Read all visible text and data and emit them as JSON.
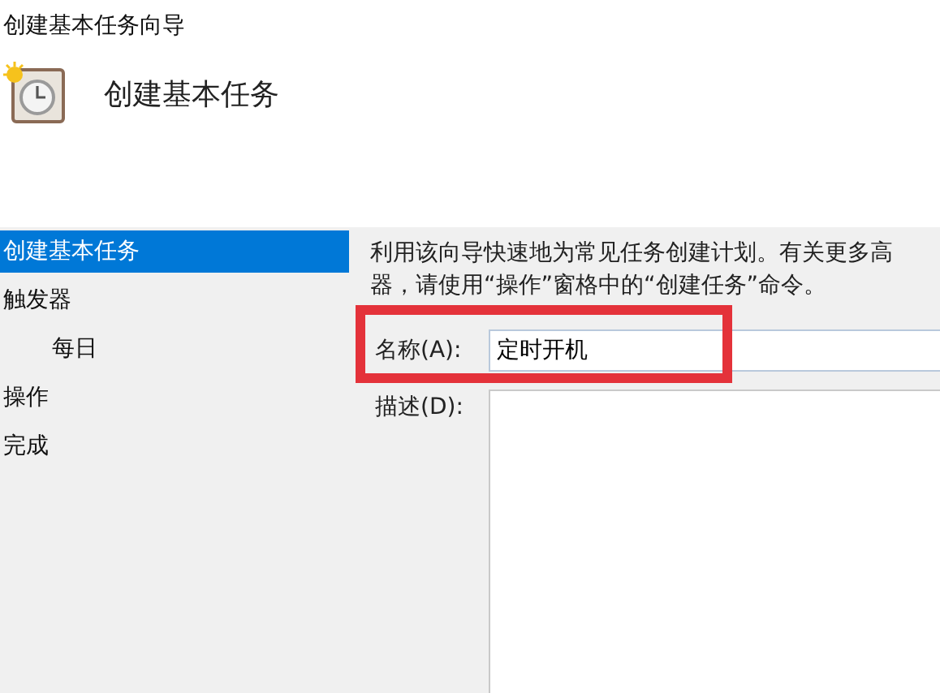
{
  "window": {
    "title": "创建基本任务向导"
  },
  "header": {
    "title": "创建基本任务"
  },
  "sidebar": {
    "items": [
      {
        "label": "创建基本任务",
        "selected": true
      },
      {
        "label": "触发器",
        "selected": false,
        "children": [
          {
            "label": "每日",
            "selected": false
          }
        ]
      },
      {
        "label": "操作",
        "selected": false
      },
      {
        "label": "完成",
        "selected": false
      }
    ]
  },
  "description": {
    "lines": [
      "利用该向导快速地为常见任务创建计划。有关更多高",
      "器，请使用“操作”窗格中的“创建任务”命令。"
    ]
  },
  "form": {
    "name_label": "名称(A):",
    "name_value": "定时开机",
    "name_highlighted": true,
    "description_label": "描述(D):"
  }
}
